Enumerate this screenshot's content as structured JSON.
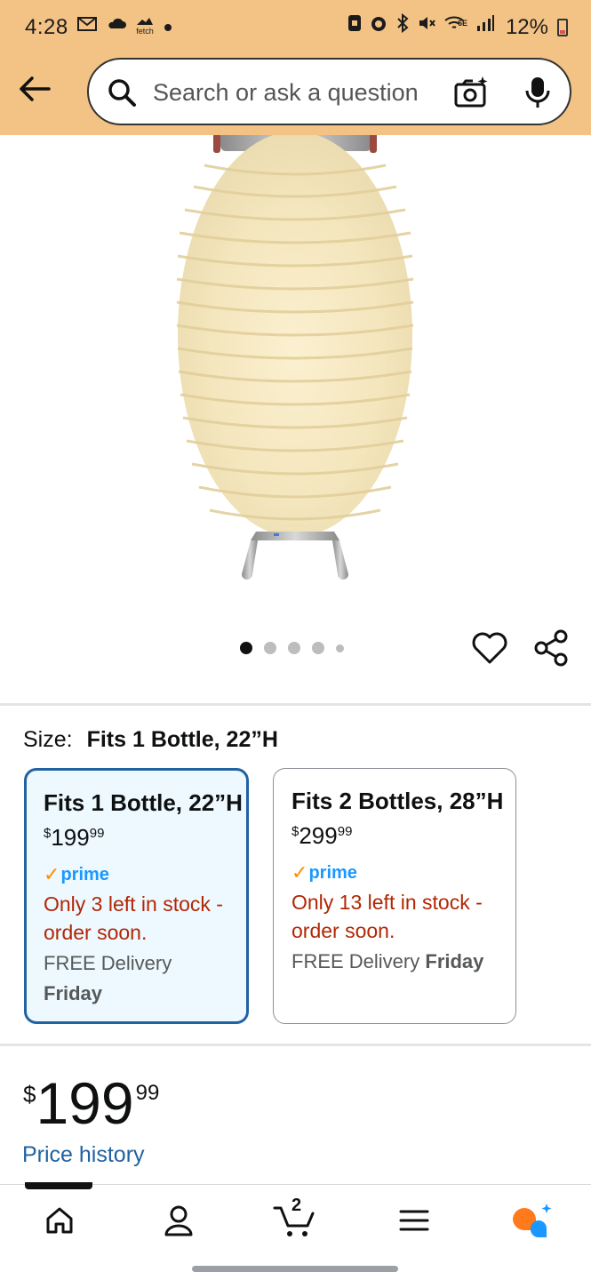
{
  "status_bar": {
    "time": "4:28",
    "left_icons": [
      "gmail-icon",
      "cloud-icon",
      "fetch-icon",
      "dot-icon"
    ],
    "fetch_label": "fetch",
    "network_label": "6E",
    "battery": "12%"
  },
  "header": {
    "search_placeholder": "Search or ask a question"
  },
  "gallery": {
    "image_count": 5,
    "active_index": 0
  },
  "size": {
    "label": "Size:",
    "selected_value": "Fits 1 Bottle, 22”H",
    "options": [
      {
        "title": "Fits 1 Bottle, 22”H",
        "price_symbol": "$",
        "price_whole": "199",
        "price_cents": "99",
        "prime": "prime",
        "stock": "Only 3 left in stock - order soon.",
        "delivery_prefix": "FREE Delivery",
        "delivery_day": "Friday"
      },
      {
        "title": "Fits 2 Bottles, 28”H",
        "price_symbol": "$",
        "price_whole": "299",
        "price_cents": "99",
        "prime": "prime",
        "stock": "Only 13 left in stock - order soon.",
        "delivery_prefix": "FREE Delivery",
        "delivery_day": "Friday"
      }
    ]
  },
  "price": {
    "symbol": "$",
    "whole": "199",
    "cents": "99",
    "history_link": "Price history"
  },
  "bottom_nav": {
    "items": [
      "home-icon",
      "account-icon",
      "cart-icon",
      "menu-icon",
      "rufus-icon"
    ],
    "cart_count": "2"
  },
  "colors": {
    "header_bg": "#f3c385",
    "selected_border": "#2162a1",
    "selected_bg": "#edf8ff",
    "stock_red": "#b12704",
    "link_blue": "#2162a1",
    "prime_blue": "#1a98ff",
    "prime_check": "#ff8f00"
  }
}
